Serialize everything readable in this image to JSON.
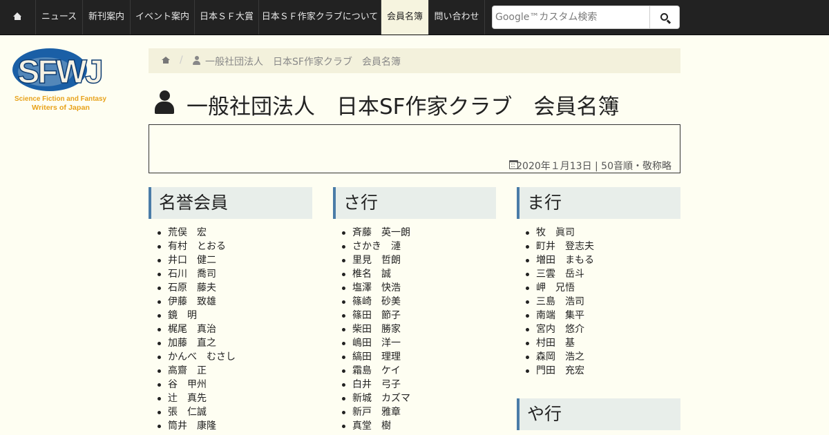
{
  "nav": {
    "home_icon": "home-icon",
    "items": [
      {
        "label": "ニュース"
      },
      {
        "label": "新刊案内"
      },
      {
        "label": "イベント案内"
      },
      {
        "label": "日本ＳＦ大賞"
      },
      {
        "label": "日本ＳＦ作家クラブについて"
      },
      {
        "label": "会員名簿",
        "active": true
      },
      {
        "label": "問い合わせ"
      }
    ],
    "search": {
      "placeholder": "Google™カスタム検索",
      "value": "",
      "button_icon": "search-icon"
    }
  },
  "logo": {
    "main": "SFWJ",
    "line1": "Science Fiction and Fantasy",
    "line2": "Writers of Japan"
  },
  "breadcrumb": {
    "home_icon": "home-icon",
    "separator": "/",
    "current_icon": "user-icon",
    "current": "一般社団法人　日本SF作家クラブ　会員名簿"
  },
  "page": {
    "title_icon": "user-icon",
    "title": "一般社団法人　日本SF作家クラブ　会員名簿"
  },
  "info": {
    "icon": "calendar-icon",
    "text": "2020年１月13日 | 50音順・敬称略"
  },
  "sections": [
    {
      "heading": "名誉会員",
      "members": [
        "荒俣　宏",
        "有村　とおる",
        "井口　健二",
        "石川　喬司",
        "石原　藤夫",
        "伊藤　致雄",
        "鏡　明",
        "梶尾　真治",
        "加藤　直之",
        "かんべ　むさし",
        "高齋　正",
        "谷　甲州",
        "辻　真先",
        "張　仁誠",
        "筒井　康隆"
      ]
    },
    {
      "heading": "さ行",
      "members": [
        "斉藤　英一朗",
        "さかき　漣",
        "里見　哲朗",
        "椎名　誠",
        "塩澤　快浩",
        "篠崎　砂美",
        "篠田　節子",
        "柴田　勝家",
        "嶋田　洋一",
        "縞田　理理",
        "霜島　ケイ",
        "白井　弓子",
        "新城　カズマ",
        "新戸　雅章",
        "真堂　樹"
      ]
    },
    {
      "heading": "ま行",
      "members": [
        "牧　眞司",
        "町井　登志夫",
        "増田　まもる",
        "三雲　岳斗",
        "岬　兄悟",
        "三島　浩司",
        "南端　集平",
        "宮内　悠介",
        "村田　基",
        "森岡　浩之",
        "門田　充宏"
      ]
    },
    {
      "heading": "や行",
      "members": []
    }
  ]
}
